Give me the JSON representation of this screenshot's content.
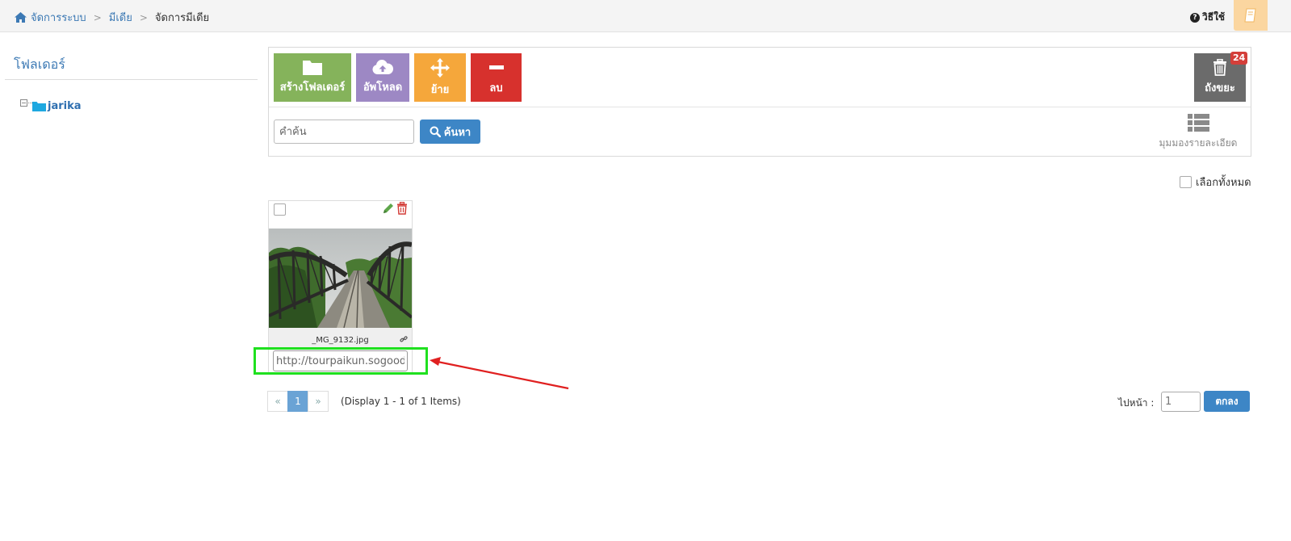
{
  "breadcrumb": {
    "items": [
      "จัดการระบบ",
      "มีเดีย",
      "จัดการมีเดีย"
    ]
  },
  "header": {
    "help_label": "วิธีใช้"
  },
  "sidebar": {
    "title": "โฟลเดอร์",
    "tree": [
      {
        "label": "jarika",
        "expanded": true
      }
    ]
  },
  "toolbar": {
    "new_folder_label": "สร้างโฟลเดอร์",
    "upload_label": "อัพโหลด",
    "move_label": "ย้าย",
    "delete_label": "ลบ",
    "trash_label": "ถังขยะ",
    "trash_count": "24"
  },
  "search": {
    "placeholder": "คำค้น",
    "button_label": "ค้นหา"
  },
  "view": {
    "detail_view_label": "มุมมองรายละเอียด"
  },
  "select_all_label": "เลือกทั้งหมด",
  "media": [
    {
      "filename": "_MG_9132.jpg",
      "url": "http://tourpaikun.sogoodweb"
    }
  ],
  "pagination": {
    "prev": "«",
    "current": "1",
    "next": "»",
    "display_text": "(Display 1 - 1 of 1 Items)",
    "goto_label": "ไปหน้า :",
    "goto_value": "1",
    "goto_button": "ตกลง"
  },
  "colors": {
    "new_folder": "#85b35b",
    "upload": "#9d88c4",
    "move": "#f5a73b",
    "delete": "#d7312d",
    "trash": "#6b6b6b",
    "primary": "#3d86c6",
    "highlight": "#1fe01f",
    "annotation_arrow": "#e02020"
  }
}
